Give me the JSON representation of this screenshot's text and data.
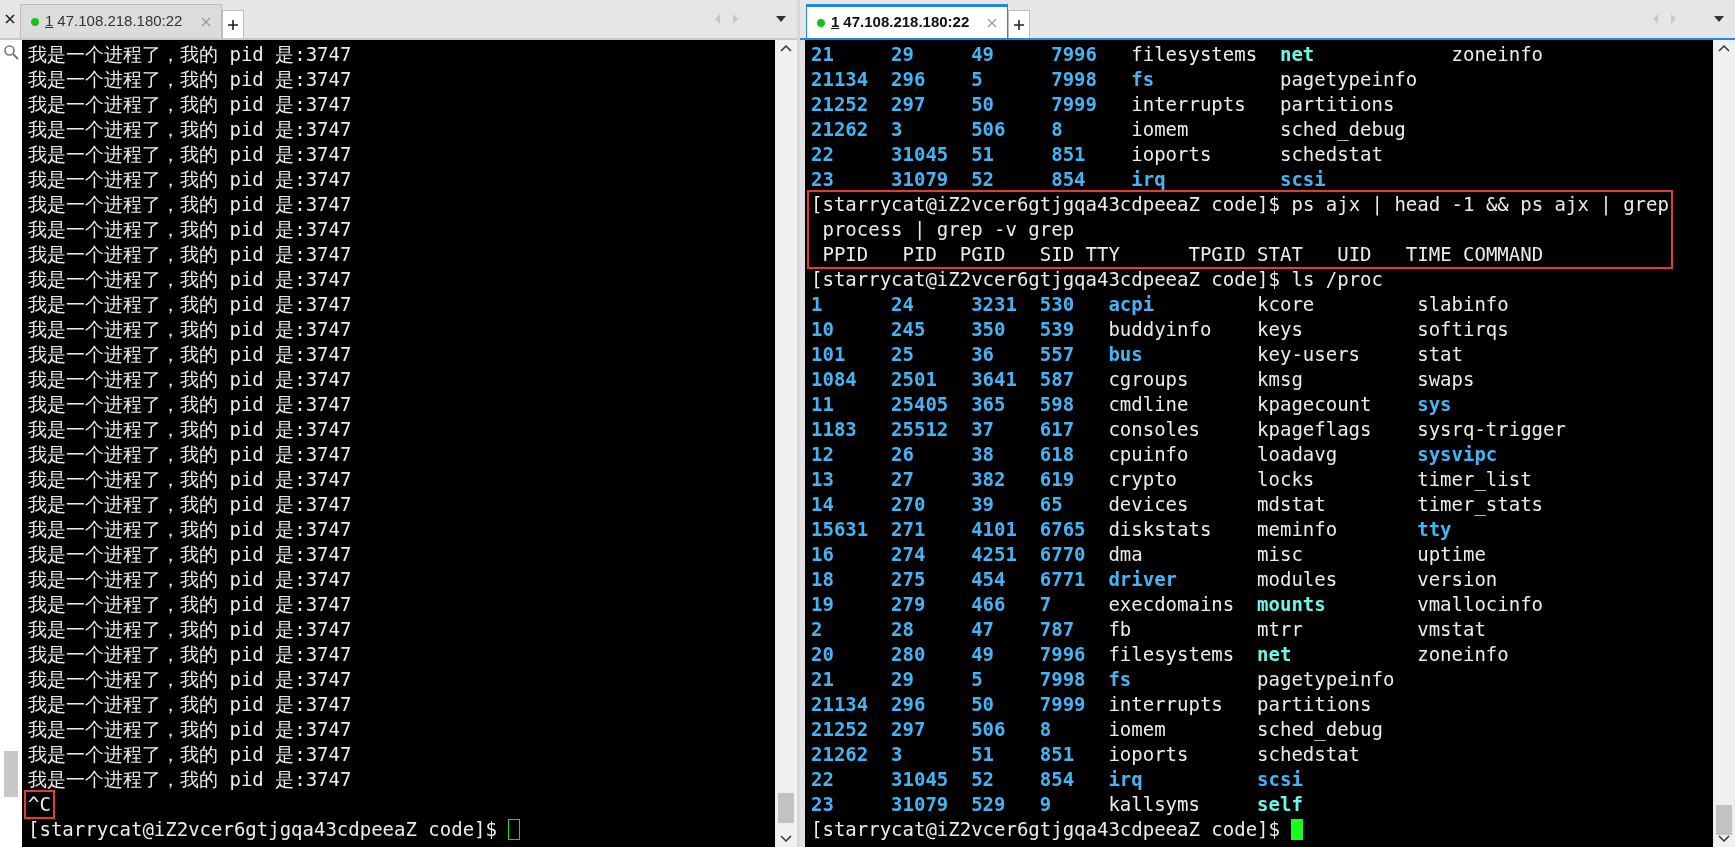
{
  "panes": [
    {
      "tab": {
        "number": "1",
        "host": "47.108.218.180:22",
        "connected": true,
        "selected": false
      },
      "blocks": [
        {
          "boxed": false,
          "lines": [
            {
              "kind": "text",
              "text": "我是一个进程了，我的 pid 是:3747"
            },
            {
              "kind": "text",
              "text": "我是一个进程了，我的 pid 是:3747"
            },
            {
              "kind": "text",
              "text": "我是一个进程了，我的 pid 是:3747"
            },
            {
              "kind": "text",
              "text": "我是一个进程了，我的 pid 是:3747"
            },
            {
              "kind": "text",
              "text": "我是一个进程了，我的 pid 是:3747"
            },
            {
              "kind": "text",
              "text": "我是一个进程了，我的 pid 是:3747"
            },
            {
              "kind": "text",
              "text": "我是一个进程了，我的 pid 是:3747"
            },
            {
              "kind": "text",
              "text": "我是一个进程了，我的 pid 是:3747"
            },
            {
              "kind": "text",
              "text": "我是一个进程了，我的 pid 是:3747"
            },
            {
              "kind": "text",
              "text": "我是一个进程了，我的 pid 是:3747"
            },
            {
              "kind": "text",
              "text": "我是一个进程了，我的 pid 是:3747"
            },
            {
              "kind": "text",
              "text": "我是一个进程了，我的 pid 是:3747"
            },
            {
              "kind": "text",
              "text": "我是一个进程了，我的 pid 是:3747"
            },
            {
              "kind": "text",
              "text": "我是一个进程了，我的 pid 是:3747"
            },
            {
              "kind": "text",
              "text": "我是一个进程了，我的 pid 是:3747"
            },
            {
              "kind": "text",
              "text": "我是一个进程了，我的 pid 是:3747"
            },
            {
              "kind": "text",
              "text": "我是一个进程了，我的 pid 是:3747"
            },
            {
              "kind": "text",
              "text": "我是一个进程了，我的 pid 是:3747"
            },
            {
              "kind": "text",
              "text": "我是一个进程了，我的 pid 是:3747"
            },
            {
              "kind": "text",
              "text": "我是一个进程了，我的 pid 是:3747"
            },
            {
              "kind": "text",
              "text": "我是一个进程了，我的 pid 是:3747"
            },
            {
              "kind": "text",
              "text": "我是一个进程了，我的 pid 是:3747"
            },
            {
              "kind": "text",
              "text": "我是一个进程了，我的 pid 是:3747"
            },
            {
              "kind": "text",
              "text": "我是一个进程了，我的 pid 是:3747"
            },
            {
              "kind": "text",
              "text": "我是一个进程了，我的 pid 是:3747"
            },
            {
              "kind": "text",
              "text": "我是一个进程了，我的 pid 是:3747"
            },
            {
              "kind": "text",
              "text": "我是一个进程了，我的 pid 是:3747"
            },
            {
              "kind": "text",
              "text": "我是一个进程了，我的 pid 是:3747"
            },
            {
              "kind": "text",
              "text": "我是一个进程了，我的 pid 是:3747"
            },
            {
              "kind": "text",
              "text": "我是一个进程了，我的 pid 是:3747"
            }
          ]
        },
        {
          "boxed": true,
          "lines": [
            {
              "kind": "text",
              "text": "^C"
            }
          ]
        },
        {
          "boxed": false,
          "lines": [
            {
              "kind": "prompt",
              "text": "[starrycat@iZ2vcer6gtjgqa43cdpeeaZ code]$",
              "cursor_filled": false
            }
          ]
        }
      ]
    },
    {
      "tab": {
        "number": "1",
        "host": "47.108.218.180:22",
        "connected": true,
        "selected": true
      },
      "blocks": [
        {
          "boxed": false,
          "lines": [
            {
              "kind": "columns",
              "cells": [
                {
                  "text": "21",
                  "kind": "dir"
                },
                {
                  "text": "29",
                  "kind": "dir"
                },
                {
                  "text": "49",
                  "kind": "dir"
                },
                {
                  "text": "7996",
                  "kind": "dir"
                },
                {
                  "text": "filesystems",
                  "kind": "file"
                },
                {
                  "text": "net",
                  "kind": "link"
                },
                {
                  "text": "zoneinfo",
                  "kind": "file"
                }
              ]
            },
            {
              "kind": "columns",
              "cells": [
                {
                  "text": "21134",
                  "kind": "dir"
                },
                {
                  "text": "296",
                  "kind": "dir"
                },
                {
                  "text": "5",
                  "kind": "dir"
                },
                {
                  "text": "7998",
                  "kind": "dir"
                },
                {
                  "text": "fs",
                  "kind": "dir"
                },
                {
                  "text": "pagetypeinfo",
                  "kind": "file"
                }
              ]
            },
            {
              "kind": "columns",
              "cells": [
                {
                  "text": "21252",
                  "kind": "dir"
                },
                {
                  "text": "297",
                  "kind": "dir"
                },
                {
                  "text": "50",
                  "kind": "dir"
                },
                {
                  "text": "7999",
                  "kind": "dir"
                },
                {
                  "text": "interrupts",
                  "kind": "file"
                },
                {
                  "text": "partitions",
                  "kind": "file"
                }
              ]
            },
            {
              "kind": "columns",
              "cells": [
                {
                  "text": "21262",
                  "kind": "dir"
                },
                {
                  "text": "3",
                  "kind": "dir"
                },
                {
                  "text": "506",
                  "kind": "dir"
                },
                {
                  "text": "8",
                  "kind": "dir"
                },
                {
                  "text": "iomem",
                  "kind": "file"
                },
                {
                  "text": "sched_debug",
                  "kind": "file"
                }
              ]
            },
            {
              "kind": "columns",
              "cells": [
                {
                  "text": "22",
                  "kind": "dir"
                },
                {
                  "text": "31045",
                  "kind": "dir"
                },
                {
                  "text": "51",
                  "kind": "dir"
                },
                {
                  "text": "851",
                  "kind": "dir"
                },
                {
                  "text": "ioports",
                  "kind": "file"
                },
                {
                  "text": "schedstat",
                  "kind": "file"
                }
              ]
            },
            {
              "kind": "columns",
              "cells": [
                {
                  "text": "23",
                  "kind": "dir"
                },
                {
                  "text": "31079",
                  "kind": "dir"
                },
                {
                  "text": "52",
                  "kind": "dir"
                },
                {
                  "text": "854",
                  "kind": "dir"
                },
                {
                  "text": "irq",
                  "kind": "dir"
                },
                {
                  "text": "scsi",
                  "kind": "dir"
                }
              ]
            }
          ]
        },
        {
          "boxed": true,
          "lines": [
            {
              "kind": "text",
              "text": "[starrycat@iZ2vcer6gtjgqa43cdpeeaZ code]$ ps ajx | head -1 && ps ajx | grep"
            },
            {
              "kind": "text",
              "text": " process | grep -v grep"
            },
            {
              "kind": "text",
              "text": " PPID   PID  PGID   SID TTY      TPGID STAT   UID   TIME COMMAND"
            }
          ]
        },
        {
          "boxed": false,
          "lines": [
            {
              "kind": "text",
              "text": "[starrycat@iZ2vcer6gtjgqa43cdpeeaZ code]$ ls /proc"
            },
            {
              "kind": "columns",
              "cells": [
                {
                  "text": "1",
                  "kind": "dir"
                },
                {
                  "text": "24",
                  "kind": "dir"
                },
                {
                  "text": "3231",
                  "kind": "dir"
                },
                {
                  "text": "530",
                  "kind": "dir"
                },
                {
                  "text": "acpi",
                  "kind": "dir"
                },
                {
                  "text": "kcore",
                  "kind": "file"
                },
                {
                  "text": "slabinfo",
                  "kind": "file"
                }
              ]
            },
            {
              "kind": "columns",
              "cells": [
                {
                  "text": "10",
                  "kind": "dir"
                },
                {
                  "text": "245",
                  "kind": "dir"
                },
                {
                  "text": "350",
                  "kind": "dir"
                },
                {
                  "text": "539",
                  "kind": "dir"
                },
                {
                  "text": "buddyinfo",
                  "kind": "file"
                },
                {
                  "text": "keys",
                  "kind": "file"
                },
                {
                  "text": "softirqs",
                  "kind": "file"
                }
              ]
            },
            {
              "kind": "columns",
              "cells": [
                {
                  "text": "101",
                  "kind": "dir"
                },
                {
                  "text": "25",
                  "kind": "dir"
                },
                {
                  "text": "36",
                  "kind": "dir"
                },
                {
                  "text": "557",
                  "kind": "dir"
                },
                {
                  "text": "bus",
                  "kind": "dir"
                },
                {
                  "text": "key-users",
                  "kind": "file"
                },
                {
                  "text": "stat",
                  "kind": "file"
                }
              ]
            },
            {
              "kind": "columns",
              "cells": [
                {
                  "text": "1084",
                  "kind": "dir"
                },
                {
                  "text": "2501",
                  "kind": "dir"
                },
                {
                  "text": "3641",
                  "kind": "dir"
                },
                {
                  "text": "587",
                  "kind": "dir"
                },
                {
                  "text": "cgroups",
                  "kind": "file"
                },
                {
                  "text": "kmsg",
                  "kind": "file"
                },
                {
                  "text": "swaps",
                  "kind": "file"
                }
              ]
            },
            {
              "kind": "columns",
              "cells": [
                {
                  "text": "11",
                  "kind": "dir"
                },
                {
                  "text": "25405",
                  "kind": "dir"
                },
                {
                  "text": "365",
                  "kind": "dir"
                },
                {
                  "text": "598",
                  "kind": "dir"
                },
                {
                  "text": "cmdline",
                  "kind": "file"
                },
                {
                  "text": "kpagecount",
                  "kind": "file"
                },
                {
                  "text": "sys",
                  "kind": "dir"
                }
              ]
            },
            {
              "kind": "columns",
              "cells": [
                {
                  "text": "1183",
                  "kind": "dir"
                },
                {
                  "text": "25512",
                  "kind": "dir"
                },
                {
                  "text": "37",
                  "kind": "dir"
                },
                {
                  "text": "617",
                  "kind": "dir"
                },
                {
                  "text": "consoles",
                  "kind": "file"
                },
                {
                  "text": "kpageflags",
                  "kind": "file"
                },
                {
                  "text": "sysrq-trigger",
                  "kind": "file"
                }
              ]
            },
            {
              "kind": "columns",
              "cells": [
                {
                  "text": "12",
                  "kind": "dir"
                },
                {
                  "text": "26",
                  "kind": "dir"
                },
                {
                  "text": "38",
                  "kind": "dir"
                },
                {
                  "text": "618",
                  "kind": "dir"
                },
                {
                  "text": "cpuinfo",
                  "kind": "file"
                },
                {
                  "text": "loadavg",
                  "kind": "file"
                },
                {
                  "text": "sysvipc",
                  "kind": "dir"
                }
              ]
            },
            {
              "kind": "columns",
              "cells": [
                {
                  "text": "13",
                  "kind": "dir"
                },
                {
                  "text": "27",
                  "kind": "dir"
                },
                {
                  "text": "382",
                  "kind": "dir"
                },
                {
                  "text": "619",
                  "kind": "dir"
                },
                {
                  "text": "crypto",
                  "kind": "file"
                },
                {
                  "text": "locks",
                  "kind": "file"
                },
                {
                  "text": "timer_list",
                  "kind": "file"
                }
              ]
            },
            {
              "kind": "columns",
              "cells": [
                {
                  "text": "14",
                  "kind": "dir"
                },
                {
                  "text": "270",
                  "kind": "dir"
                },
                {
                  "text": "39",
                  "kind": "dir"
                },
                {
                  "text": "65",
                  "kind": "dir"
                },
                {
                  "text": "devices",
                  "kind": "file"
                },
                {
                  "text": "mdstat",
                  "kind": "file"
                },
                {
                  "text": "timer_stats",
                  "kind": "file"
                }
              ]
            },
            {
              "kind": "columns",
              "cells": [
                {
                  "text": "15631",
                  "kind": "dir"
                },
                {
                  "text": "271",
                  "kind": "dir"
                },
                {
                  "text": "4101",
                  "kind": "dir"
                },
                {
                  "text": "6765",
                  "kind": "dir"
                },
                {
                  "text": "diskstats",
                  "kind": "file"
                },
                {
                  "text": "meminfo",
                  "kind": "file"
                },
                {
                  "text": "tty",
                  "kind": "dir"
                }
              ]
            },
            {
              "kind": "columns",
              "cells": [
                {
                  "text": "16",
                  "kind": "dir"
                },
                {
                  "text": "274",
                  "kind": "dir"
                },
                {
                  "text": "4251",
                  "kind": "dir"
                },
                {
                  "text": "6770",
                  "kind": "dir"
                },
                {
                  "text": "dma",
                  "kind": "file"
                },
                {
                  "text": "misc",
                  "kind": "file"
                },
                {
                  "text": "uptime",
                  "kind": "file"
                }
              ]
            },
            {
              "kind": "columns",
              "cells": [
                {
                  "text": "18",
                  "kind": "dir"
                },
                {
                  "text": "275",
                  "kind": "dir"
                },
                {
                  "text": "454",
                  "kind": "dir"
                },
                {
                  "text": "6771",
                  "kind": "dir"
                },
                {
                  "text": "driver",
                  "kind": "dir"
                },
                {
                  "text": "modules",
                  "kind": "file"
                },
                {
                  "text": "version",
                  "kind": "file"
                }
              ]
            },
            {
              "kind": "columns",
              "cells": [
                {
                  "text": "19",
                  "kind": "dir"
                },
                {
                  "text": "279",
                  "kind": "dir"
                },
                {
                  "text": "466",
                  "kind": "dir"
                },
                {
                  "text": "7",
                  "kind": "dir"
                },
                {
                  "text": "execdomains",
                  "kind": "file"
                },
                {
                  "text": "mounts",
                  "kind": "link"
                },
                {
                  "text": "vmallocinfo",
                  "kind": "file"
                }
              ]
            },
            {
              "kind": "columns",
              "cells": [
                {
                  "text": "2",
                  "kind": "dir"
                },
                {
                  "text": "28",
                  "kind": "dir"
                },
                {
                  "text": "47",
                  "kind": "dir"
                },
                {
                  "text": "787",
                  "kind": "dir"
                },
                {
                  "text": "fb",
                  "kind": "file"
                },
                {
                  "text": "mtrr",
                  "kind": "file"
                },
                {
                  "text": "vmstat",
                  "kind": "file"
                }
              ]
            },
            {
              "kind": "columns",
              "cells": [
                {
                  "text": "20",
                  "kind": "dir"
                },
                {
                  "text": "280",
                  "kind": "dir"
                },
                {
                  "text": "49",
                  "kind": "dir"
                },
                {
                  "text": "7996",
                  "kind": "dir"
                },
                {
                  "text": "filesystems",
                  "kind": "file"
                },
                {
                  "text": "net",
                  "kind": "link"
                },
                {
                  "text": "zoneinfo",
                  "kind": "file"
                }
              ]
            },
            {
              "kind": "columns",
              "cells": [
                {
                  "text": "21",
                  "kind": "dir"
                },
                {
                  "text": "29",
                  "kind": "dir"
                },
                {
                  "text": "5",
                  "kind": "dir"
                },
                {
                  "text": "7998",
                  "kind": "dir"
                },
                {
                  "text": "fs",
                  "kind": "dir"
                },
                {
                  "text": "pagetypeinfo",
                  "kind": "file"
                }
              ]
            },
            {
              "kind": "columns",
              "cells": [
                {
                  "text": "21134",
                  "kind": "dir"
                },
                {
                  "text": "296",
                  "kind": "dir"
                },
                {
                  "text": "50",
                  "kind": "dir"
                },
                {
                  "text": "7999",
                  "kind": "dir"
                },
                {
                  "text": "interrupts",
                  "kind": "file"
                },
                {
                  "text": "partitions",
                  "kind": "file"
                }
              ]
            },
            {
              "kind": "columns",
              "cells": [
                {
                  "text": "21252",
                  "kind": "dir"
                },
                {
                  "text": "297",
                  "kind": "dir"
                },
                {
                  "text": "506",
                  "kind": "dir"
                },
                {
                  "text": "8",
                  "kind": "dir"
                },
                {
                  "text": "iomem",
                  "kind": "file"
                },
                {
                  "text": "sched_debug",
                  "kind": "file"
                }
              ]
            },
            {
              "kind": "columns",
              "cells": [
                {
                  "text": "21262",
                  "kind": "dir"
                },
                {
                  "text": "3",
                  "kind": "dir"
                },
                {
                  "text": "51",
                  "kind": "dir"
                },
                {
                  "text": "851",
                  "kind": "dir"
                },
                {
                  "text": "ioports",
                  "kind": "file"
                },
                {
                  "text": "schedstat",
                  "kind": "file"
                }
              ]
            },
            {
              "kind": "columns",
              "cells": [
                {
                  "text": "22",
                  "kind": "dir"
                },
                {
                  "text": "31045",
                  "kind": "dir"
                },
                {
                  "text": "52",
                  "kind": "dir"
                },
                {
                  "text": "854",
                  "kind": "dir"
                },
                {
                  "text": "irq",
                  "kind": "dir"
                },
                {
                  "text": "scsi",
                  "kind": "dir"
                }
              ]
            },
            {
              "kind": "columns",
              "cells": [
                {
                  "text": "23",
                  "kind": "dir"
                },
                {
                  "text": "31079",
                  "kind": "dir"
                },
                {
                  "text": "529",
                  "kind": "dir"
                },
                {
                  "text": "9",
                  "kind": "dir"
                },
                {
                  "text": "kallsyms",
                  "kind": "file"
                },
                {
                  "text": "self",
                  "kind": "link"
                }
              ]
            },
            {
              "kind": "prompt",
              "text": "[starrycat@iZ2vcer6gtjgqa43cdpeeaZ code]$",
              "cursor_filled": true
            }
          ]
        }
      ]
    }
  ]
}
